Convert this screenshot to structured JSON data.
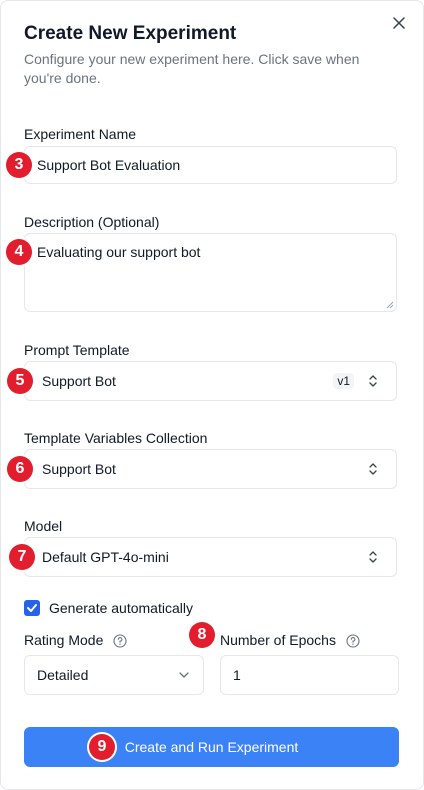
{
  "dialog": {
    "title": "Create New Experiment",
    "subtitle": "Configure your new experiment here. Click save when you're done."
  },
  "form": {
    "experiment_name_label": "Experiment Name",
    "experiment_name_value": "Support Bot Evaluation",
    "description_label": "Description (Optional)",
    "description_value": "Evaluating our support bot",
    "prompt_template_label": "Prompt Template",
    "prompt_template_value": "Support Bot",
    "prompt_template_version": "v1",
    "template_variables_label": "Template Variables Collection",
    "template_variables_value": "Support Bot",
    "model_label": "Model",
    "model_value": "Default GPT-4o-mini",
    "generate_auto_label": "Generate automatically",
    "rating_mode_label": "Rating Mode",
    "rating_mode_value": "Detailed",
    "epochs_label": "Number of Epochs",
    "epochs_value": "1",
    "submit_label": "Create and Run Experiment"
  },
  "badges": [
    "3",
    "4",
    "5",
    "6",
    "7",
    "8",
    "9"
  ],
  "colors": {
    "primary": "#3b82f6",
    "checkbox": "#2563eb",
    "badge": "#e11d2e"
  },
  "icons": [
    "close-icon",
    "chevron-up-down-icon",
    "chevron-down-icon",
    "help-circle-icon",
    "checkmark-icon",
    "resize-handle-icon"
  ]
}
